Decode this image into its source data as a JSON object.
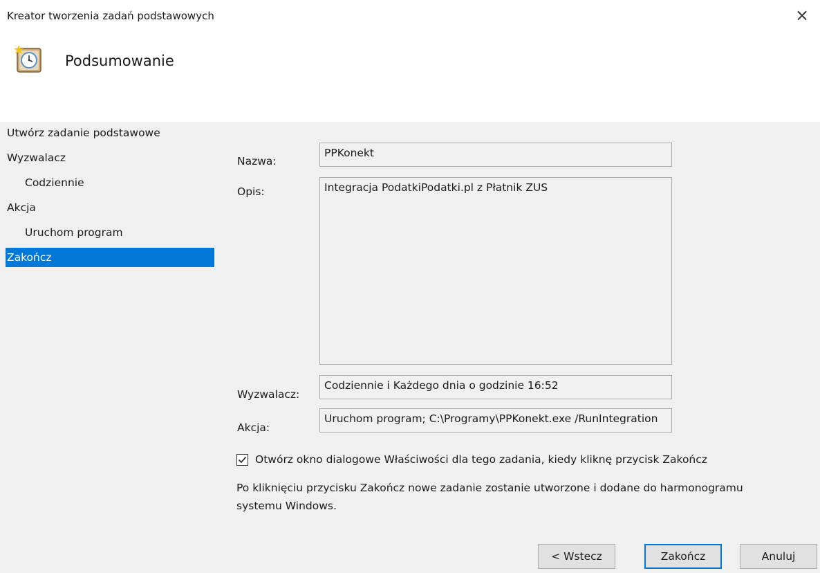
{
  "window": {
    "title": "Kreator tworzenia zadań podstawowych",
    "close_glyph": "×"
  },
  "header": {
    "icon": "scheduled-task-clock-icon",
    "title": "Podsumowanie"
  },
  "nav": {
    "items": [
      {
        "label": "Utwórz zadanie podstawowe"
      },
      {
        "label": "Wyzwalacz"
      },
      {
        "label": "Codziennie"
      },
      {
        "label": "Akcja"
      },
      {
        "label": "Uruchom program"
      },
      {
        "label": "Zakończ"
      }
    ]
  },
  "summary": {
    "name_label": "Nazwa:",
    "name_value": "PPKonekt",
    "description_label": "Opis:",
    "description_value": "Integracja PodatkiPodatki.pl z Płatnik ZUS",
    "trigger_label": "Wyzwalacz:",
    "trigger_value": "Codziennie i Każdego dnia o godzinie 16:52",
    "action_label": "Akcja:",
    "action_value": "Uruchom program; C:\\Programy\\PPKonekt.exe /RunIntegration"
  },
  "options": {
    "open_properties_label": "Otwórz okno dialogowe Właściwości dla tego zadania, kiedy kliknę przycisk Zakończ",
    "open_properties_checked": true,
    "info_text": "Po kliknięciu przycisku Zakończ nowe zadanie zostanie utworzone i dodane do harmonogramu systemu Windows."
  },
  "buttons": {
    "back_label": "< Wstecz",
    "finish_label": "Zakończ",
    "cancel_label": "Anuluj"
  },
  "colors": {
    "selection": "#0078d7",
    "body_background": "#f0f0f0",
    "default_button_border": "#0078d7"
  }
}
